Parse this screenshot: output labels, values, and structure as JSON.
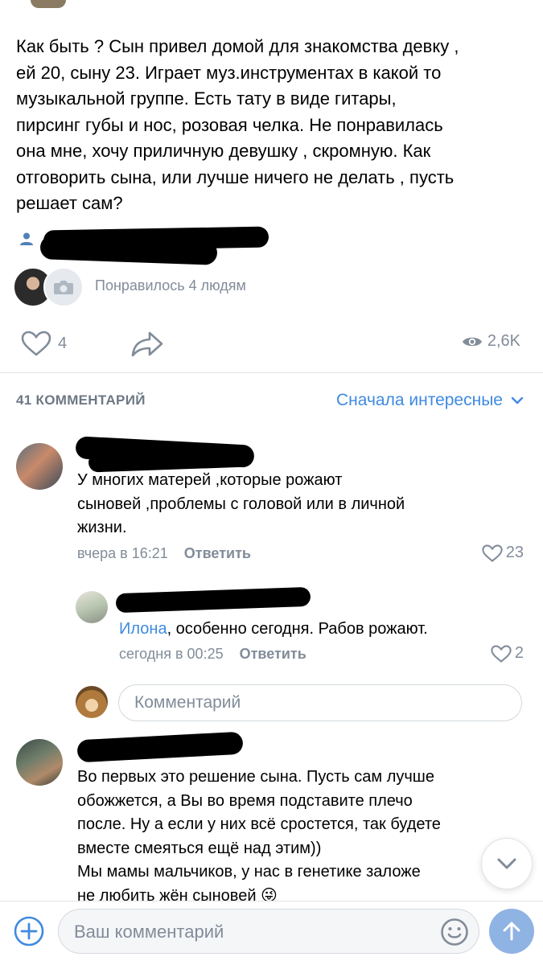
{
  "post": {
    "text": "Как быть ? Сын привел домой для знакомства девку ,\nей 20, сыну 23. Играет муз.инструментах в какой то\nмузыкальной группе. Есть тату в виде гитары,\nпирсинг губы и нос, розовая челка. Не понравилась\nона мне, хочу приличную девушку , скромную. Как\nотговорить сына, или лучше ничего не делать , пусть\nрешает сам?"
  },
  "likers": {
    "text": "Понравилось 4 людям"
  },
  "actions": {
    "like_count": "4",
    "views_count": "2,6K",
    "icons": [
      "heart-icon",
      "share-icon",
      "eye-icon"
    ]
  },
  "comments_header": {
    "count_label": "41 КОММЕНТАРИЙ",
    "sort_label": "Сначала интересные"
  },
  "comments": [
    {
      "body": "У многих матерей ,которые рожают\nсыновей ,проблемы с головой или  в личной\nжизни.",
      "time": "вчера в 16:21",
      "reply_label": "Ответить",
      "likes": "23"
    },
    {
      "mention": "Илона",
      "body": ", особенно сегодня. Рабов рожают.",
      "time": "сегодня в 00:25",
      "reply_label": "Ответить",
      "likes": "2"
    },
    {
      "body": "Во первых это решение сына. Пусть сам лучше\nобожжется, а Вы во время подставите плечо\nпосле. Ну а если у них всё сростется, так будете\nвместе смеяться ещё над этим))\nМы мамы мальчиков, у нас в генетике заложе\nне любить жён сыновей 😜"
    }
  ],
  "reply_input": {
    "placeholder": "Комментарий"
  },
  "composer": {
    "placeholder": "Ваш комментарий"
  },
  "colors": {
    "accent": "#3f8ae0",
    "secondary_text": "#818c99",
    "header_text": "#6d7885",
    "send_button": "#8fb3e3"
  }
}
